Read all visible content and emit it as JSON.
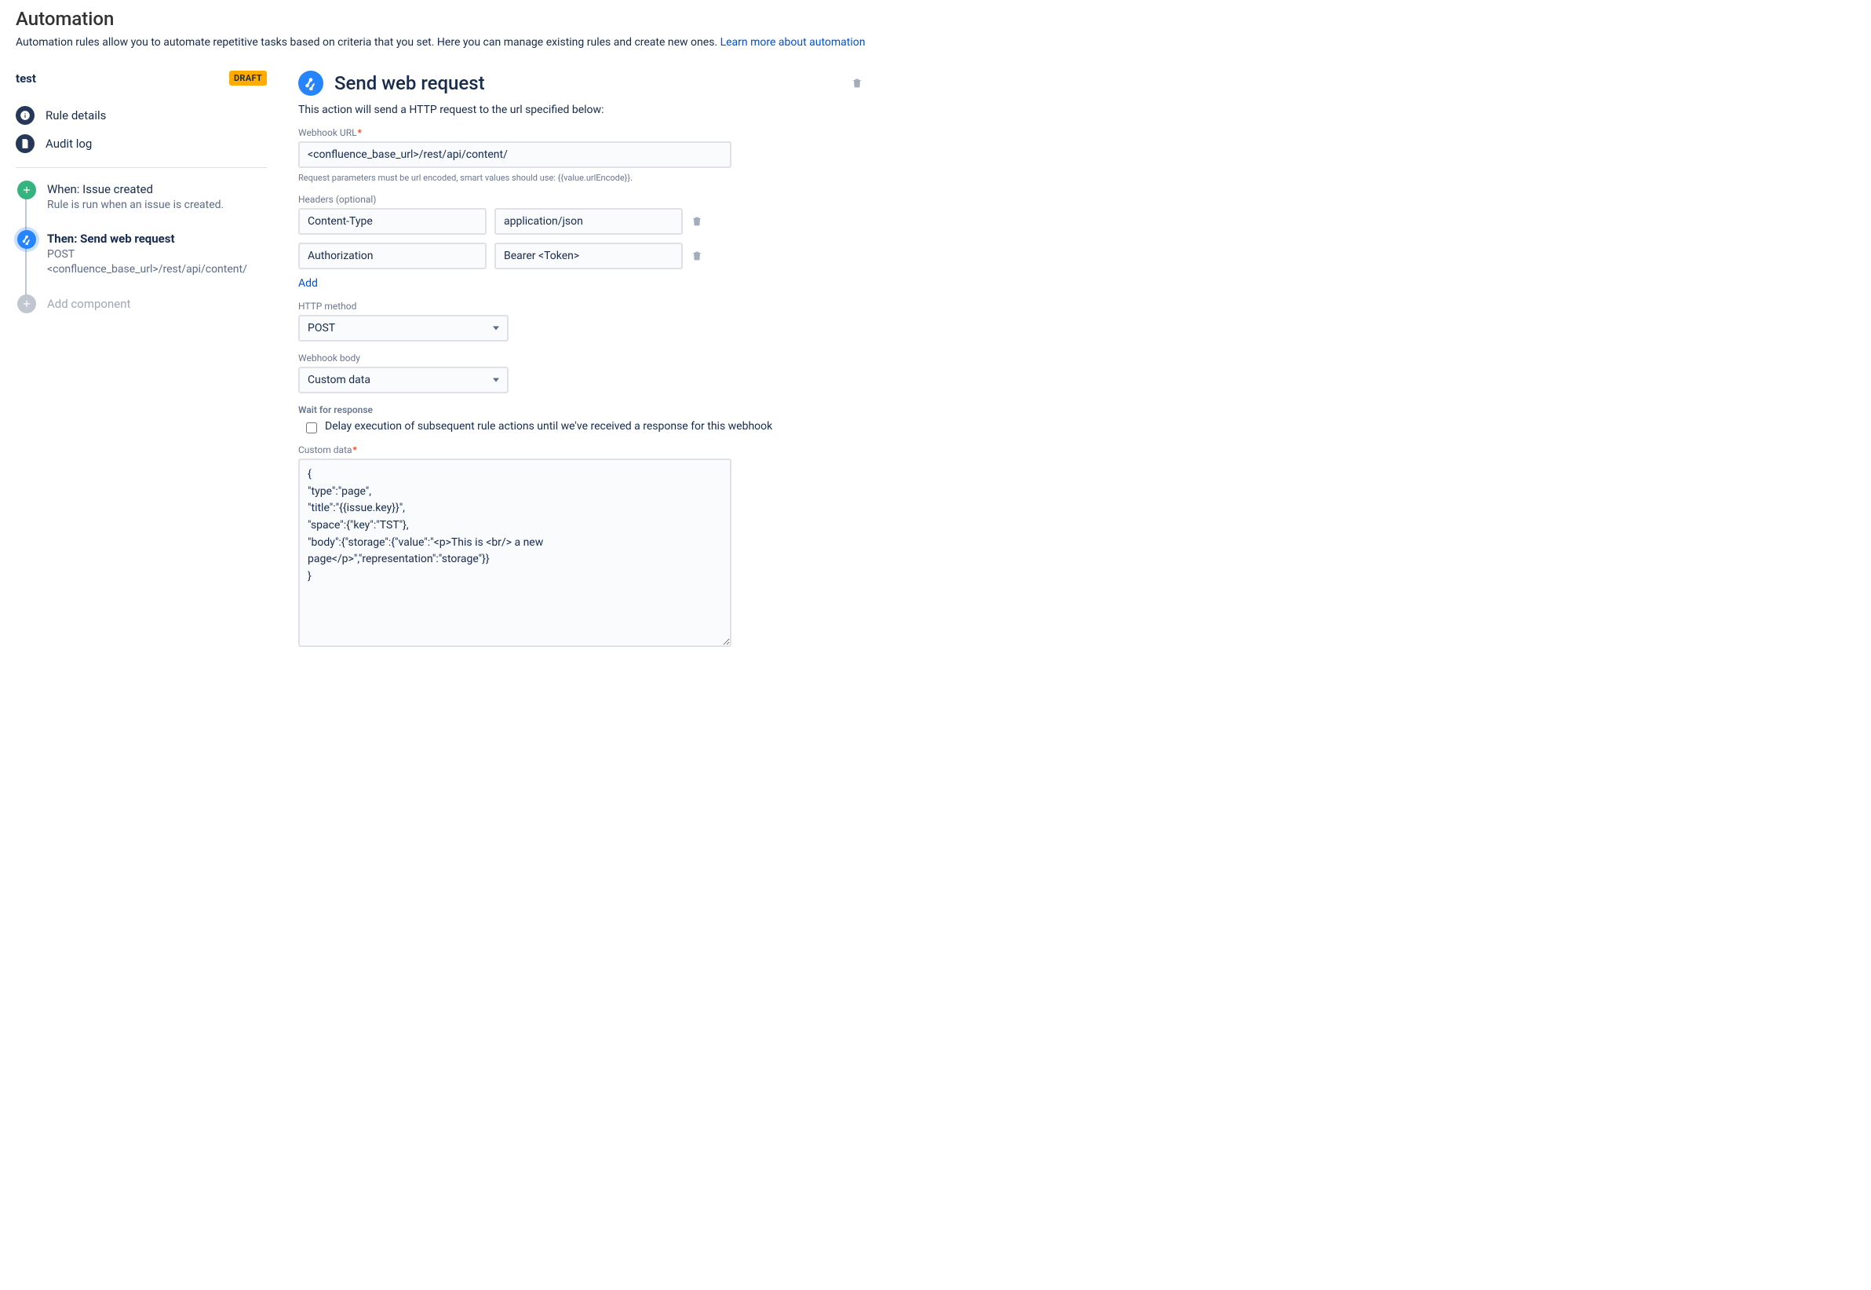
{
  "page": {
    "title": "Automation",
    "description": "Automation rules allow you to automate repetitive tasks based on criteria that you set. Here you can manage existing rules and create new ones.",
    "learn_more": "Learn more about automation"
  },
  "rule": {
    "name": "test",
    "badge": "DRAFT"
  },
  "nav": {
    "rule_details": "Rule details",
    "audit_log": "Audit log"
  },
  "timeline": {
    "when": {
      "title": "When: Issue created",
      "sub": "Rule is run when an issue is created."
    },
    "then": {
      "title": "Then: Send web request",
      "sub": "POST <confluence_base_url>/rest/api/content/"
    },
    "add": "Add component"
  },
  "panel": {
    "title": "Send web request",
    "description": "This action will send a HTTP request to the url specified below:",
    "webhook_url_label": "Webhook URL",
    "webhook_url_value": "<confluence_base_url>/rest/api/content/",
    "webhook_url_help": "Request parameters must be url encoded, smart values should use: {{value.urlEncode}}.",
    "headers_label": "Headers (optional)",
    "headers": [
      {
        "key": "Content-Type",
        "value": "application/json"
      },
      {
        "key": "Authorization",
        "value": "Bearer <Token>"
      }
    ],
    "add_label": "Add",
    "http_method_label": "HTTP method",
    "http_method_value": "POST",
    "webhook_body_label": "Webhook body",
    "webhook_body_value": "Custom data",
    "wait_label": "Wait for response",
    "wait_checkbox_label": "Delay execution of subsequent rule actions until we've received a response for this webhook",
    "custom_data_label": "Custom data",
    "custom_data_value": "{\n\"type\":\"page\",\n\"title\":\"{{issue.key}}\",\n\"space\":{\"key\":\"TST\"},\n\"body\":{\"storage\":{\"value\":\"<p>This is <br/> a new page</p>\",\"representation\":\"storage\"}}\n}"
  }
}
